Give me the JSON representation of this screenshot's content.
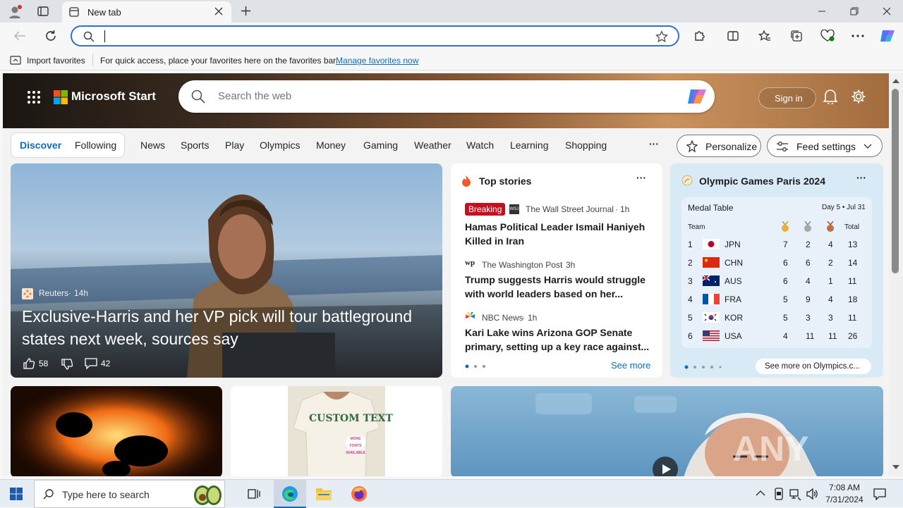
{
  "browser": {
    "tab_title": "New tab",
    "address_value": "",
    "favbar": {
      "import_label": "Import favorites",
      "hint": "For quick access, place your favorites here on the favorites bar.",
      "manage_link": "Manage favorites now"
    }
  },
  "start": {
    "brand": "Microsoft Start",
    "search_placeholder": "Search the web",
    "signin": "Sign in",
    "nav": [
      "Discover",
      "Following",
      "News",
      "Sports",
      "Play",
      "Olympics",
      "Money",
      "Gaming",
      "Weather",
      "Watch",
      "Learning",
      "Shopping"
    ],
    "more": "···",
    "personalize": "Personalize",
    "feed_settings": "Feed settings"
  },
  "hero_story": {
    "source": "Reuters",
    "age": "14h",
    "headline": "Exclusive-Harris and her VP pick will tour battleground states next week, sources say",
    "likes": "58",
    "comments": "42"
  },
  "top_stories": {
    "title": "Top stories",
    "items": [
      {
        "badge": "Breaking",
        "source_logo": "WSJ",
        "source": "The Wall Street Journal",
        "age": "1h",
        "headline": "Hamas Political Leader Ismail Haniyeh Killed in Iran"
      },
      {
        "source_logo": "wp",
        "source": "The Washington Post",
        "age": "3h",
        "headline": "Trump suggests Harris would struggle with world leaders based on her..."
      },
      {
        "source": "NBC News",
        "age": "1h",
        "headline": "Kari Lake wins Arizona GOP Senate primary, setting up a key race against..."
      }
    ],
    "see_more": "See more"
  },
  "olympics": {
    "title": "Olympic Games Paris 2024",
    "table_title": "Medal Table",
    "day": "Day 5 • Jul 31",
    "headers": {
      "team": "Team",
      "total": "Total"
    },
    "rows": [
      {
        "rank": "1",
        "team": "JPN",
        "gold": "7",
        "silver": "2",
        "bronze": "4",
        "total": "13"
      },
      {
        "rank": "2",
        "team": "CHN",
        "gold": "6",
        "silver": "6",
        "bronze": "2",
        "total": "14"
      },
      {
        "rank": "3",
        "team": "AUS",
        "gold": "6",
        "silver": "4",
        "bronze": "1",
        "total": "11"
      },
      {
        "rank": "4",
        "team": "FRA",
        "gold": "5",
        "silver": "9",
        "bronze": "4",
        "total": "18"
      },
      {
        "rank": "5",
        "team": "KOR",
        "gold": "5",
        "silver": "3",
        "bronze": "3",
        "total": "11"
      },
      {
        "rank": "6",
        "team": "USA",
        "gold": "4",
        "silver": "11",
        "bronze": "11",
        "total": "26"
      }
    ],
    "see_more": "See more on Olympics.c..."
  },
  "promo": {
    "shirt_text": "CUSTOM TEXT",
    "badge": "MORE FONTS AVAILABLE"
  },
  "watermark": "ANY RUN",
  "taskbar": {
    "search_placeholder": "Type here to search",
    "time": "7:08 AM",
    "date": "7/31/2024"
  },
  "colors": {
    "accent": "#0f6cbd",
    "breaking": "#c50f1f",
    "address_border": "#2f6fd4"
  }
}
